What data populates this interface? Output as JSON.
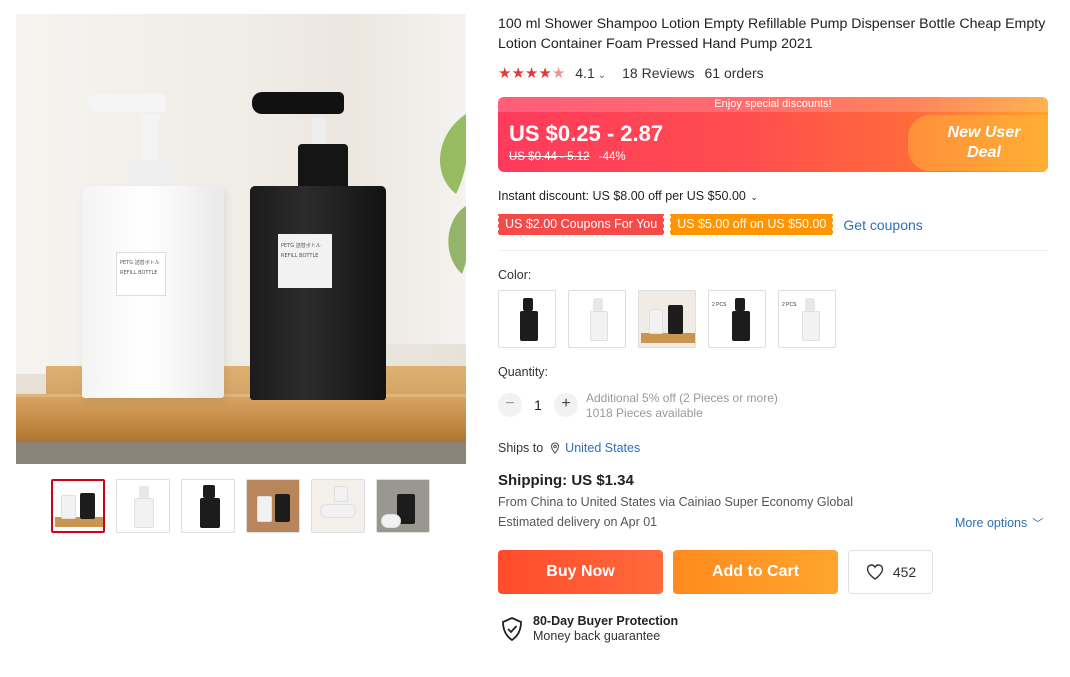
{
  "product": {
    "title": "100 ml Shower Shampoo Lotion Empty Refillable Pump Dispenser Bottle Cheap Empty Lotion Container Foam Pressed Hand Pump 2021",
    "rating": "4.1",
    "reviews": "18 Reviews",
    "orders": "61 orders",
    "star_icons": [
      "star-icon",
      "star-icon",
      "star-icon",
      "star-icon",
      "star-half-icon"
    ],
    "bottle_label_line1": "PETG 詰替ボトル",
    "bottle_label_line2": "REFILL BOTTLE"
  },
  "deal_banner": {
    "top_text": "Enjoy special discounts!",
    "price_range": "US $0.25 - 2.87",
    "original_price": "US $0.44 - 5.12",
    "discount": "-44%",
    "badge_line1": "New User",
    "badge_line2": "Deal"
  },
  "discounts": {
    "instant": "Instant discount: US $8.00 off per US $50.00",
    "coupon1": "US $2.00 Coupons For You",
    "coupon2": "US $5.00 off on US $50.00",
    "get_coupons": "Get coupons"
  },
  "color": {
    "label": "Color:",
    "tags": [
      "",
      "",
      "",
      "2 PCS",
      "2 PCS"
    ]
  },
  "quantity": {
    "label": "Quantity:",
    "value": "1",
    "minus": "−",
    "plus": "+",
    "note1": "Additional 5% off (2 Pieces or more)",
    "note2": "1018 Pieces available"
  },
  "shipping": {
    "ships_to_label": "Ships to",
    "country": "United States",
    "title": "Shipping: US $1.34",
    "route": "From China to United States via Cainiao Super Economy Global",
    "eta": "Estimated delivery on Apr 01",
    "more_options": "More options"
  },
  "actions": {
    "buy_now": "Buy Now",
    "add_to_cart": "Add to Cart",
    "wishlist_count": "452"
  },
  "protection": {
    "title": "80-Day Buyer Protection",
    "subtitle": "Money back guarantee"
  },
  "colors": {
    "accent_red": "#e4393c",
    "buy_now": "#ff4b2b",
    "add_to_cart": "#ff9a26",
    "link_blue": "#2e6fb7",
    "coupon_red": "#f44a4a",
    "coupon_orange": "#ff9500"
  }
}
